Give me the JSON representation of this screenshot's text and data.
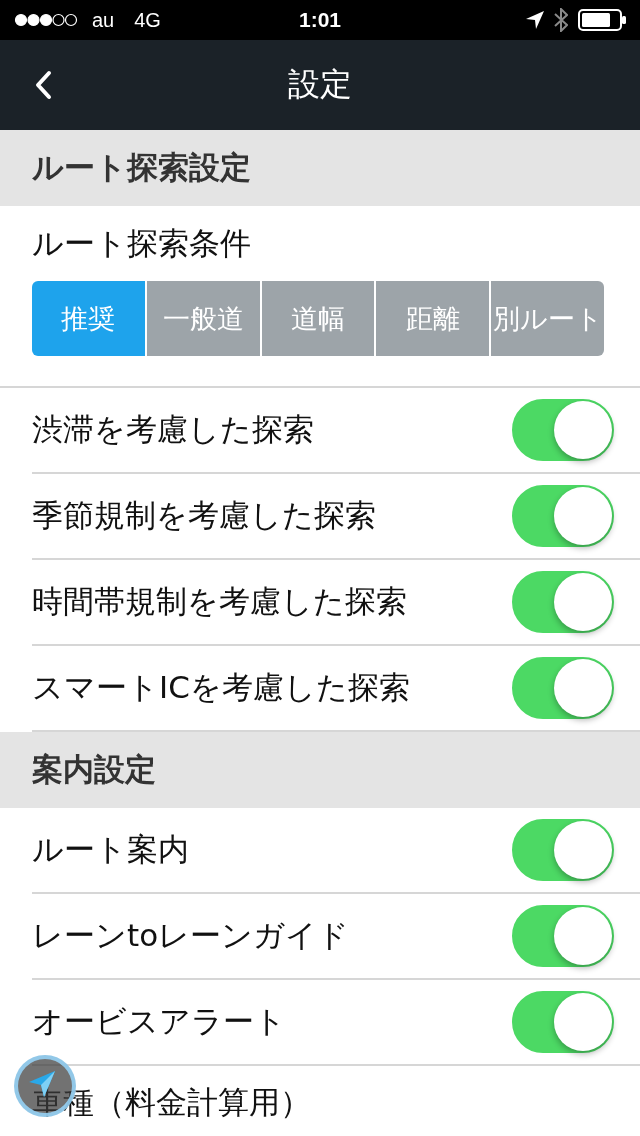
{
  "status_bar": {
    "carrier": "au",
    "network": "4G",
    "time": "1:01"
  },
  "nav_bar": {
    "title": "設定"
  },
  "sections": [
    {
      "header": "ルート探索設定",
      "rows": [
        {
          "kind": "segmented",
          "label": "ルート探索条件",
          "options": [
            {
              "label": "推奨",
              "selected": true
            },
            {
              "label": "一般道",
              "selected": false
            },
            {
              "label": "道幅",
              "selected": false
            },
            {
              "label": "距離",
              "selected": false
            },
            {
              "label": "別ルート",
              "selected": false
            }
          ]
        },
        {
          "kind": "toggle",
          "label": "渋滞を考慮した探索",
          "on": true
        },
        {
          "kind": "toggle",
          "label": "季節規制を考慮した探索",
          "on": true
        },
        {
          "kind": "toggle",
          "label": "時間帯規制を考慮した探索",
          "on": true
        },
        {
          "kind": "toggle",
          "label": "スマートICを考慮した探索",
          "on": true
        }
      ]
    },
    {
      "header": "案内設定",
      "rows": [
        {
          "kind": "toggle",
          "label": "ルート案内",
          "on": true
        },
        {
          "kind": "toggle",
          "label": "レーンtoレーンガイド",
          "on": true
        },
        {
          "kind": "toggle",
          "label": "オービスアラート",
          "on": true
        },
        {
          "kind": "link",
          "label": "車種（料金計算用）"
        }
      ]
    }
  ]
}
